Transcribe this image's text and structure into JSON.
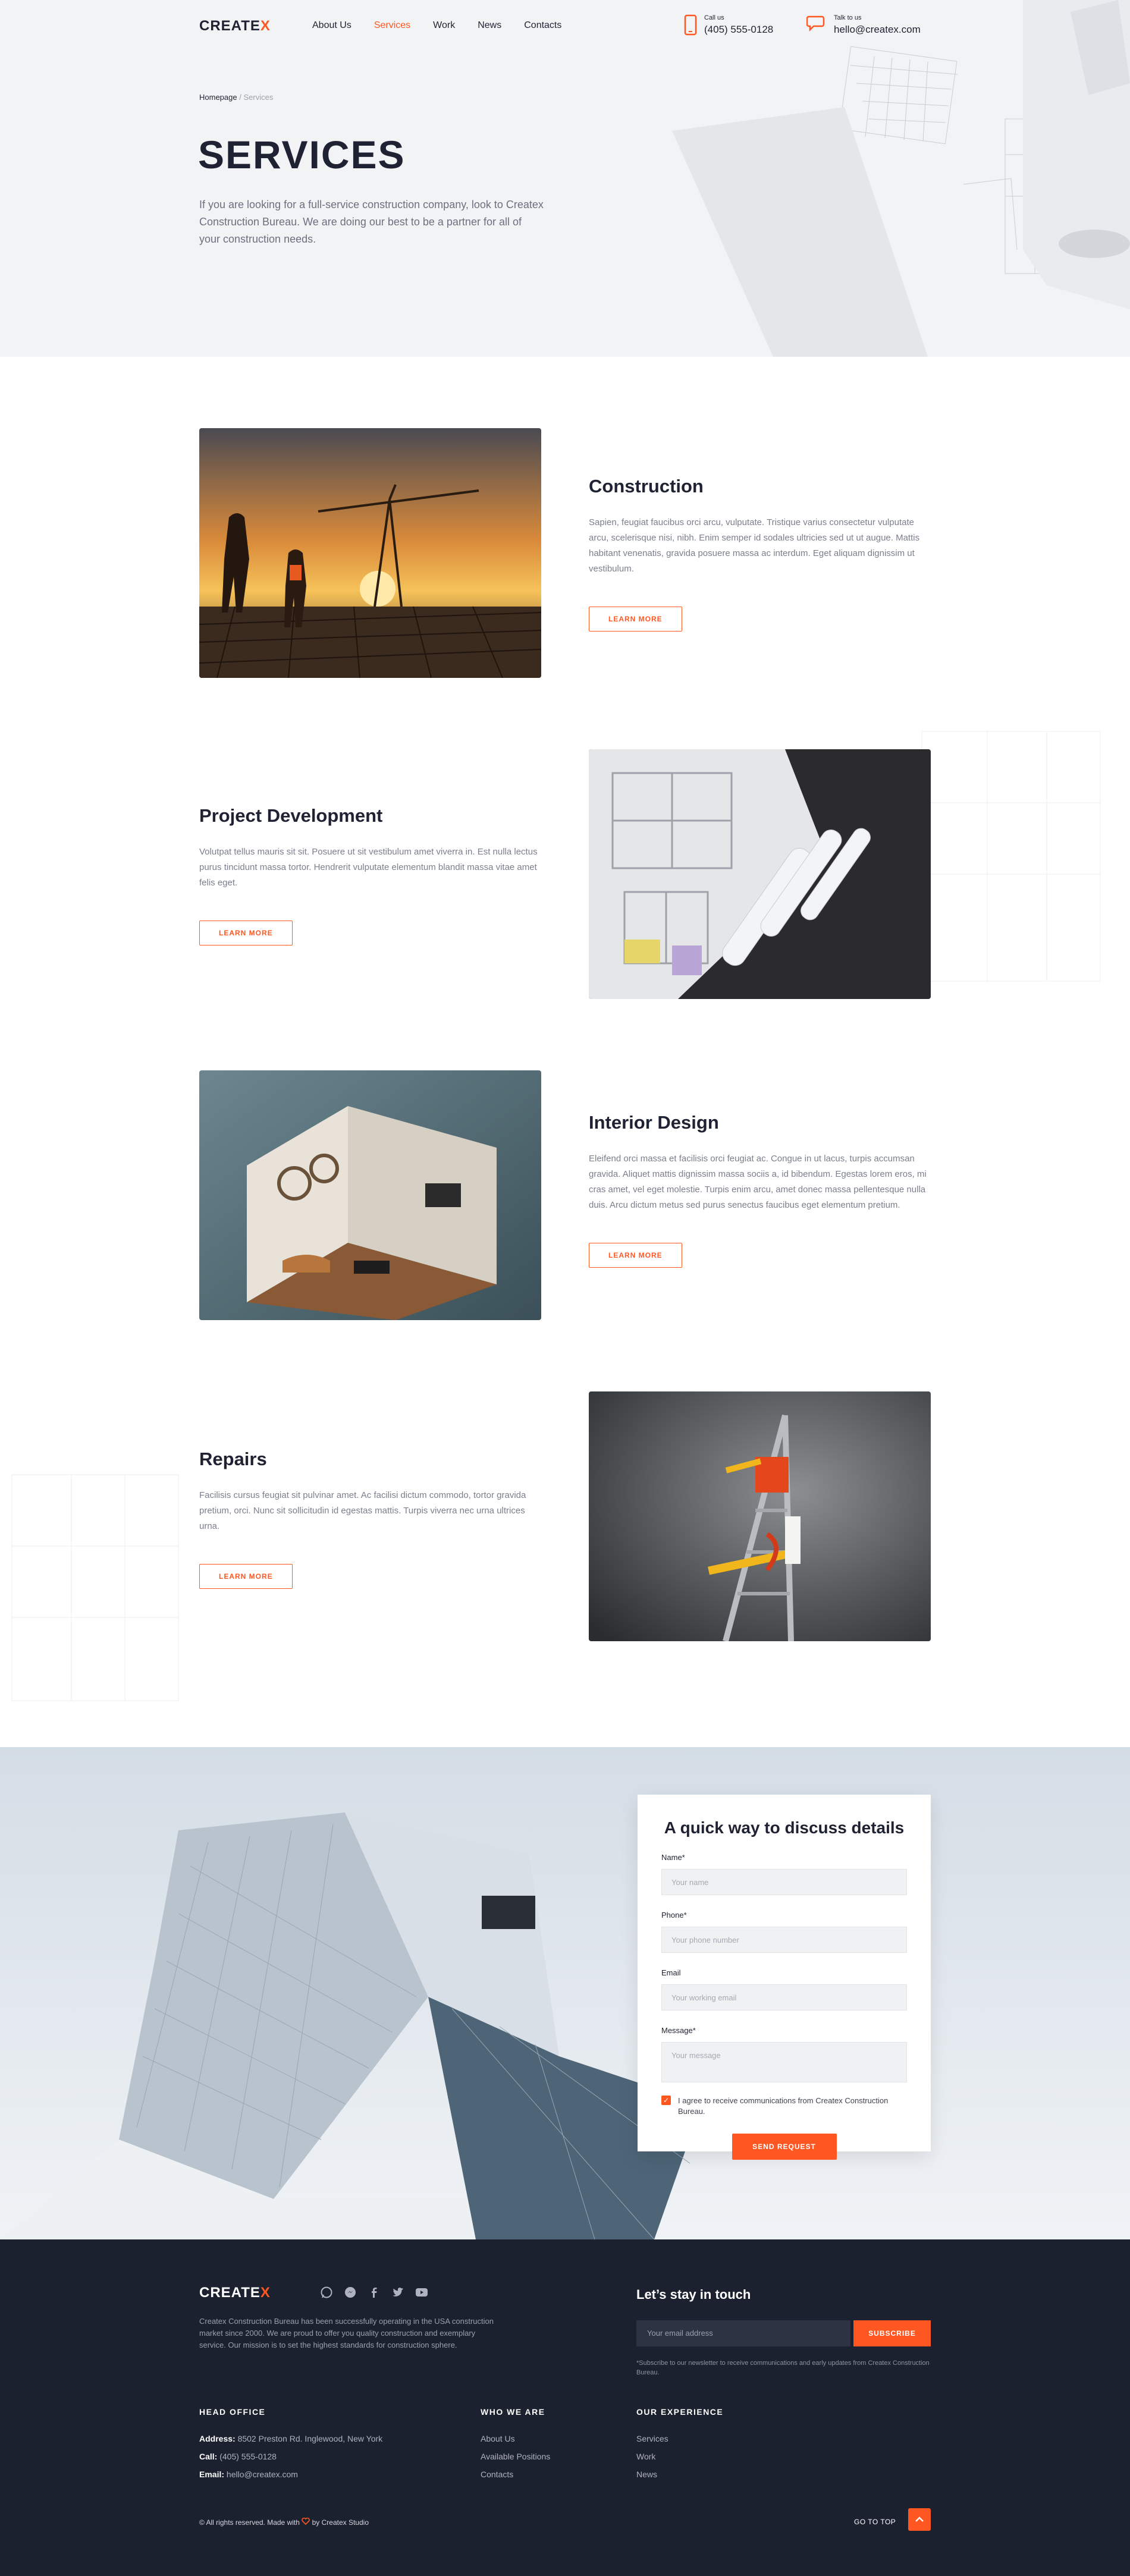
{
  "header": {
    "logo": "CREATE",
    "logo_mark": "X",
    "nav": [
      "About Us",
      "Services",
      "Work",
      "News",
      "Contacts"
    ],
    "active_nav": "Services",
    "call_label": "Call us",
    "call_value": "(405) 555-0128",
    "talk_label": "Talk to us",
    "talk_value": "hello@createx.com"
  },
  "hero": {
    "breadcrumb_home": "Homepage",
    "breadcrumb_sep": "/",
    "breadcrumb_current": "Services",
    "title": "SERVICES",
    "description": "If you are looking for a full-service construction company, look to Createx Construction Bureau. We are doing our best to be a partner for all of your construction needs."
  },
  "services": [
    {
      "title": "Construction",
      "text": "Sapien, feugiat faucibus orci arcu, vulputate. Tristique varius consectetur vulputate arcu, scelerisque nisi, nibh. Enim semper id sodales ultricies sed ut ut augue. Mattis habitant venenatis, gravida posuere massa ac interdum. Eget aliquam dignissim ut vestibulum.",
      "button": "LEARN MORE"
    },
    {
      "title": "Project Development",
      "text": "Volutpat tellus mauris sit sit. Posuere ut sit vestibulum amet viverra in. Est nulla lectus purus tincidunt massa tortor. Hendrerit vulputate elementum blandit massa vitae amet felis eget.",
      "button": "LEARN MORE"
    },
    {
      "title": "Interior Design",
      "text": "Eleifend orci massa et facilisis orci feugiat ac. Congue in ut lacus, turpis accumsan gravida. Aliquet mattis dignissim massa sociis a, id bibendum. Egestas lorem eros, mi cras amet, vel eget molestie. Turpis enim arcu, amet donec massa pellentesque nulla duis. Arcu dictum metus sed purus senectus faucibus eget elementum pretium.",
      "button": "LEARN MORE"
    },
    {
      "title": "Repairs",
      "text": "Facilisis cursus feugiat sit pulvinar amet. Ac facilisi dictum commodo, tortor gravida pretium, orci. Nunc sit sollicitudin id egestas mattis. Turpis viverra nec urna ultrices urna.",
      "button": "LEARN MORE"
    }
  ],
  "form": {
    "title": "A quick way to discuss details",
    "name_label": "Name*",
    "name_placeholder": "Your name",
    "phone_label": "Phone*",
    "phone_placeholder": "Your phone number",
    "email_label": "Email",
    "email_placeholder": "Your working email",
    "message_label": "Message*",
    "message_placeholder": "Your message",
    "consent": "I agree to receive communications from Createx Construction Bureau.",
    "consent_checked": true,
    "submit": "SEND REQUEST"
  },
  "footer": {
    "logo": "CREATE",
    "logo_mark": "X",
    "social_icons": [
      "whatsapp-icon",
      "messenger-icon",
      "facebook-icon",
      "twitter-icon",
      "youtube-icon"
    ],
    "description": "Createx Construction Bureau has been successfully operating in the USA construction market since 2000. We are proud to offer you quality construction and exemplary service. Our mission is to set the highest standards for construction sphere.",
    "newsletter_title": "Let’s stay in touch",
    "newsletter_placeholder": "Your email address",
    "subscribe": "SUBSCRIBE",
    "newsletter_note": "*Subscribe to our newsletter to receive communications and early updates from Createx Construction Bureau.",
    "head_office_title": "HEAD OFFICE",
    "address_label": "Address:",
    "address_value": "8502 Preston Rd. Inglewood, New York",
    "call_label": "Call:",
    "call_value": "(405) 555-0128",
    "email_label": "Email:",
    "email_value": "hello@createx.com",
    "who_title": "WHO WE ARE",
    "who_links": [
      "About Us",
      "Available Positions",
      "Contacts"
    ],
    "exp_title": "OUR EXPERIENCE",
    "exp_links": [
      "Services",
      "Work",
      "News"
    ],
    "copyright_pre": "© All rights reserved. Made with",
    "copyright_post": "by Createx Studio",
    "go_top": "GO TO TOP"
  },
  "colors": {
    "accent": "#ff5722",
    "dark": "#1e2232",
    "footer_bg": "#1c2130"
  }
}
